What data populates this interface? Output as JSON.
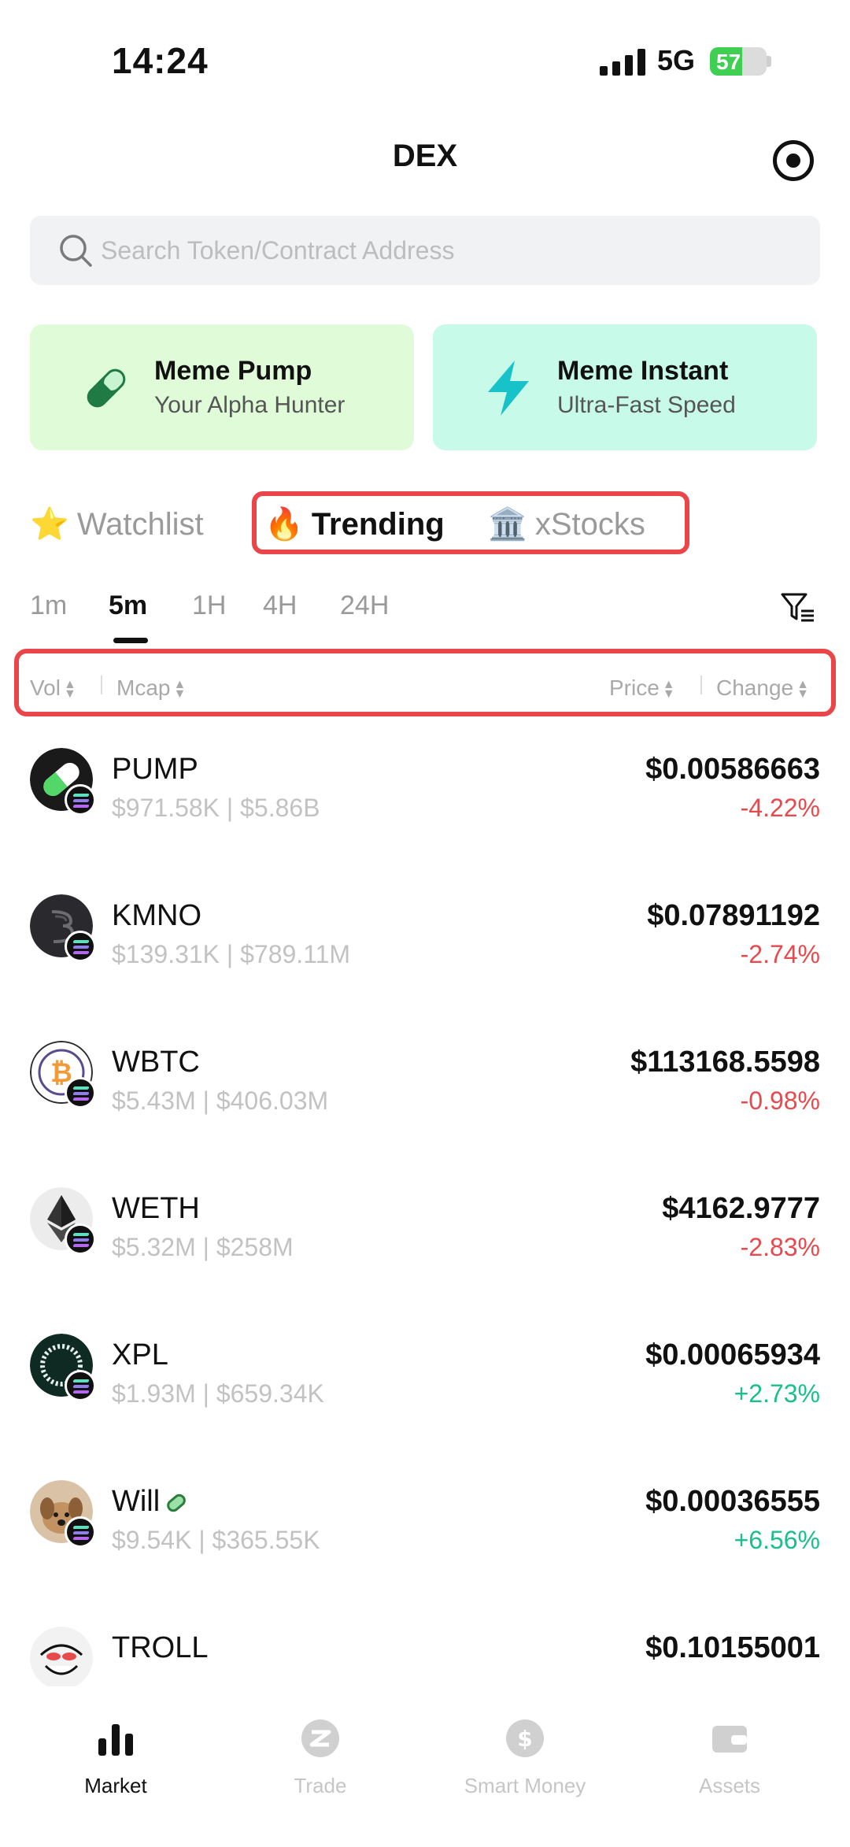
{
  "status_bar": {
    "time": "14:24",
    "network": "5G",
    "battery": "57",
    "battery_level": 0.57
  },
  "header": {
    "title": "DEX"
  },
  "search": {
    "placeholder": "Search Token/Contract Address"
  },
  "promo_cards": [
    {
      "title": "Meme Pump",
      "subtitle": "Your Alpha Hunter",
      "icon": "pill-icon"
    },
    {
      "title": "Meme Instant",
      "subtitle": "Ultra-Fast Speed",
      "icon": "lightning-icon"
    }
  ],
  "category_tabs": [
    {
      "emoji": "⭐",
      "label": "Watchlist",
      "active": false
    },
    {
      "emoji": "🔥",
      "label": "Trending",
      "active": true
    },
    {
      "emoji": "🏛️",
      "label": "xStocks",
      "active": false
    }
  ],
  "time_tabs": [
    {
      "label": "1m",
      "active": false
    },
    {
      "label": "5m",
      "active": true
    },
    {
      "label": "1H",
      "active": false
    },
    {
      "label": "4H",
      "active": false
    },
    {
      "label": "24H",
      "active": false
    }
  ],
  "sort_columns": {
    "vol": "Vol",
    "mcap": "Mcap",
    "price": "Price",
    "change": "Change"
  },
  "tokens": [
    {
      "name": "PUMP",
      "meta": "$971.58K | $5.86B",
      "price": "$0.00586663",
      "change": "-4.22%",
      "direction": "down"
    },
    {
      "name": "KMNO",
      "meta": "$139.31K | $789.11M",
      "price": "$0.07891192",
      "change": "-2.74%",
      "direction": "down"
    },
    {
      "name": "WBTC",
      "meta": "$5.43M | $406.03M",
      "price": "$113168.5598",
      "change": "-0.98%",
      "direction": "down"
    },
    {
      "name": "WETH",
      "meta": "$5.32M | $258M",
      "price": "$4162.9777",
      "change": "-2.83%",
      "direction": "down"
    },
    {
      "name": "XPL",
      "meta": "$1.93M | $659.34K",
      "price": "$0.00065934",
      "change": "+2.73%",
      "direction": "up"
    },
    {
      "name": "Will",
      "meta": "$9.54K | $365.55K",
      "price": "$0.00036555",
      "change": "+6.56%",
      "direction": "up"
    },
    {
      "name": "TROLL",
      "meta": "",
      "price": "$0.10155001",
      "change": "",
      "direction": "down"
    }
  ],
  "bottom_nav": [
    {
      "label": "Market",
      "icon": "bar-chart-icon",
      "active": true
    },
    {
      "label": "Trade",
      "icon": "trade-icon",
      "active": false
    },
    {
      "label": "Smart Money",
      "icon": "dollar-coin-icon",
      "active": false
    },
    {
      "label": "Assets",
      "icon": "wallet-icon",
      "active": false
    }
  ],
  "colors": {
    "negative": "#e8494d",
    "positive": "#19c08c",
    "highlight": "#ea4549",
    "meme_pump_bg": "#dffbd7",
    "meme_instant_bg": "#c8faea"
  }
}
